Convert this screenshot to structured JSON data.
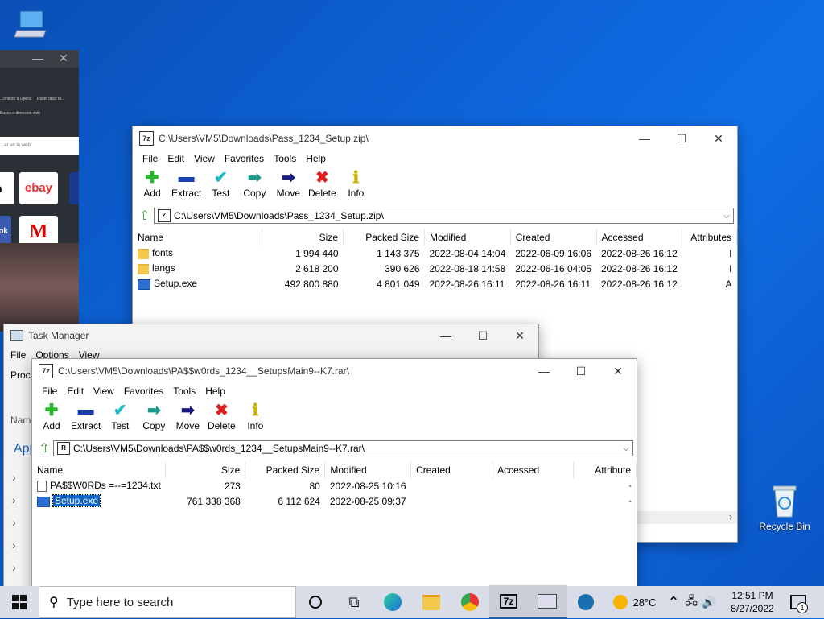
{
  "desktop": {
    "recycle_bin_label": "Recycle Bin"
  },
  "browser": {
    "close_glyph": "✕",
    "minimize_glyph": "—",
    "tab1": "...onecto a Opera",
    "tab2": "Paset tasci M...",
    "addr_hint": "Busca o direccion web",
    "search_hint": "...ar en la web",
    "tile_ebay": "ebay",
    "tile_on": "on",
    "tile_ok": "ok",
    "tile_m": "M",
    "tile_b": "Bo"
  },
  "zip_window": {
    "title": "C:\\Users\\VM5\\Downloads\\Pass_1234_Setup.zip\\",
    "menu": [
      "File",
      "Edit",
      "View",
      "Favorites",
      "Tools",
      "Help"
    ],
    "toolbar": [
      "Add",
      "Extract",
      "Test",
      "Copy",
      "Move",
      "Delete",
      "Info"
    ],
    "address": "C:\\Users\\VM5\\Downloads\\Pass_1234_Setup.zip\\",
    "columns": [
      "Name",
      "Size",
      "Packed Size",
      "Modified",
      "Created",
      "Accessed",
      "Attributes"
    ],
    "rows": [
      {
        "name": "fonts",
        "size": "1 994 440",
        "packed": "1 143 375",
        "modified": "2022-08-04 14:04",
        "created": "2022-06-09 16:06",
        "accessed": "2022-08-26 16:12",
        "attr": "I"
      },
      {
        "name": "langs",
        "size": "2 618 200",
        "packed": "390 626",
        "modified": "2022-08-18 14:58",
        "created": "2022-06-16 04:05",
        "accessed": "2022-08-26 16:12",
        "attr": "I"
      },
      {
        "name": "Setup.exe",
        "size": "492 800 880",
        "packed": "4 801 049",
        "modified": "2022-08-26 16:11",
        "created": "2022-08-26 16:11",
        "accessed": "2022-08-26 16:12",
        "attr": "A"
      }
    ]
  },
  "task_manager": {
    "title": "Task Manager",
    "menu": [
      "File",
      "Options",
      "View"
    ],
    "proc_label": "Proce",
    "name_label": "Nam",
    "apps_label": "App"
  },
  "rar_window": {
    "title": "C:\\Users\\VM5\\Downloads\\PA$$w0rds_1234__SetupsMain9--K7.rar\\",
    "menu": [
      "File",
      "Edit",
      "View",
      "Favorites",
      "Tools",
      "Help"
    ],
    "toolbar": [
      "Add",
      "Extract",
      "Test",
      "Copy",
      "Move",
      "Delete",
      "Info"
    ],
    "address": "C:\\Users\\VM5\\Downloads\\PA$$w0rds_1234__SetupsMain9--K7.rar\\",
    "columns": [
      "Name",
      "Size",
      "Packed Size",
      "Modified",
      "Created",
      "Accessed",
      "Attribute"
    ],
    "rows": [
      {
        "name": "PA$$W0RDs =--=1234.txt",
        "size": "273",
        "packed": "80",
        "modified": "2022-08-25 10:16",
        "created": "",
        "accessed": "",
        "attr": "A"
      },
      {
        "name": "Setup.exe",
        "size": "761 338 368",
        "packed": "6 112 624",
        "modified": "2022-08-25 09:37",
        "created": "",
        "accessed": "",
        "attr": "A"
      }
    ]
  },
  "taskbar": {
    "search_placeholder": "Type here to search",
    "weather": "28°C",
    "time": "12:51 PM",
    "date": "8/27/2022",
    "notifications_count": "1",
    "app_7z_label": "7z"
  },
  "colors": {
    "selection": "#0a64c8",
    "desktop_blue": "#0d63d8"
  }
}
